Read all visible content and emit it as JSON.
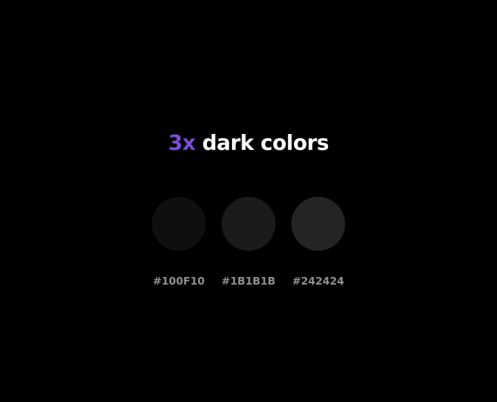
{
  "headline": {
    "accent": "3x",
    "text": "dark colors",
    "accent_color": "#7c4bd9",
    "text_color": "#ffffff"
  },
  "swatches": [
    {
      "label": "#100F10",
      "color": "#100F10"
    },
    {
      "label": "#1B1B1B",
      "color": "#1B1B1B"
    },
    {
      "label": "#242424",
      "color": "#242424"
    }
  ]
}
